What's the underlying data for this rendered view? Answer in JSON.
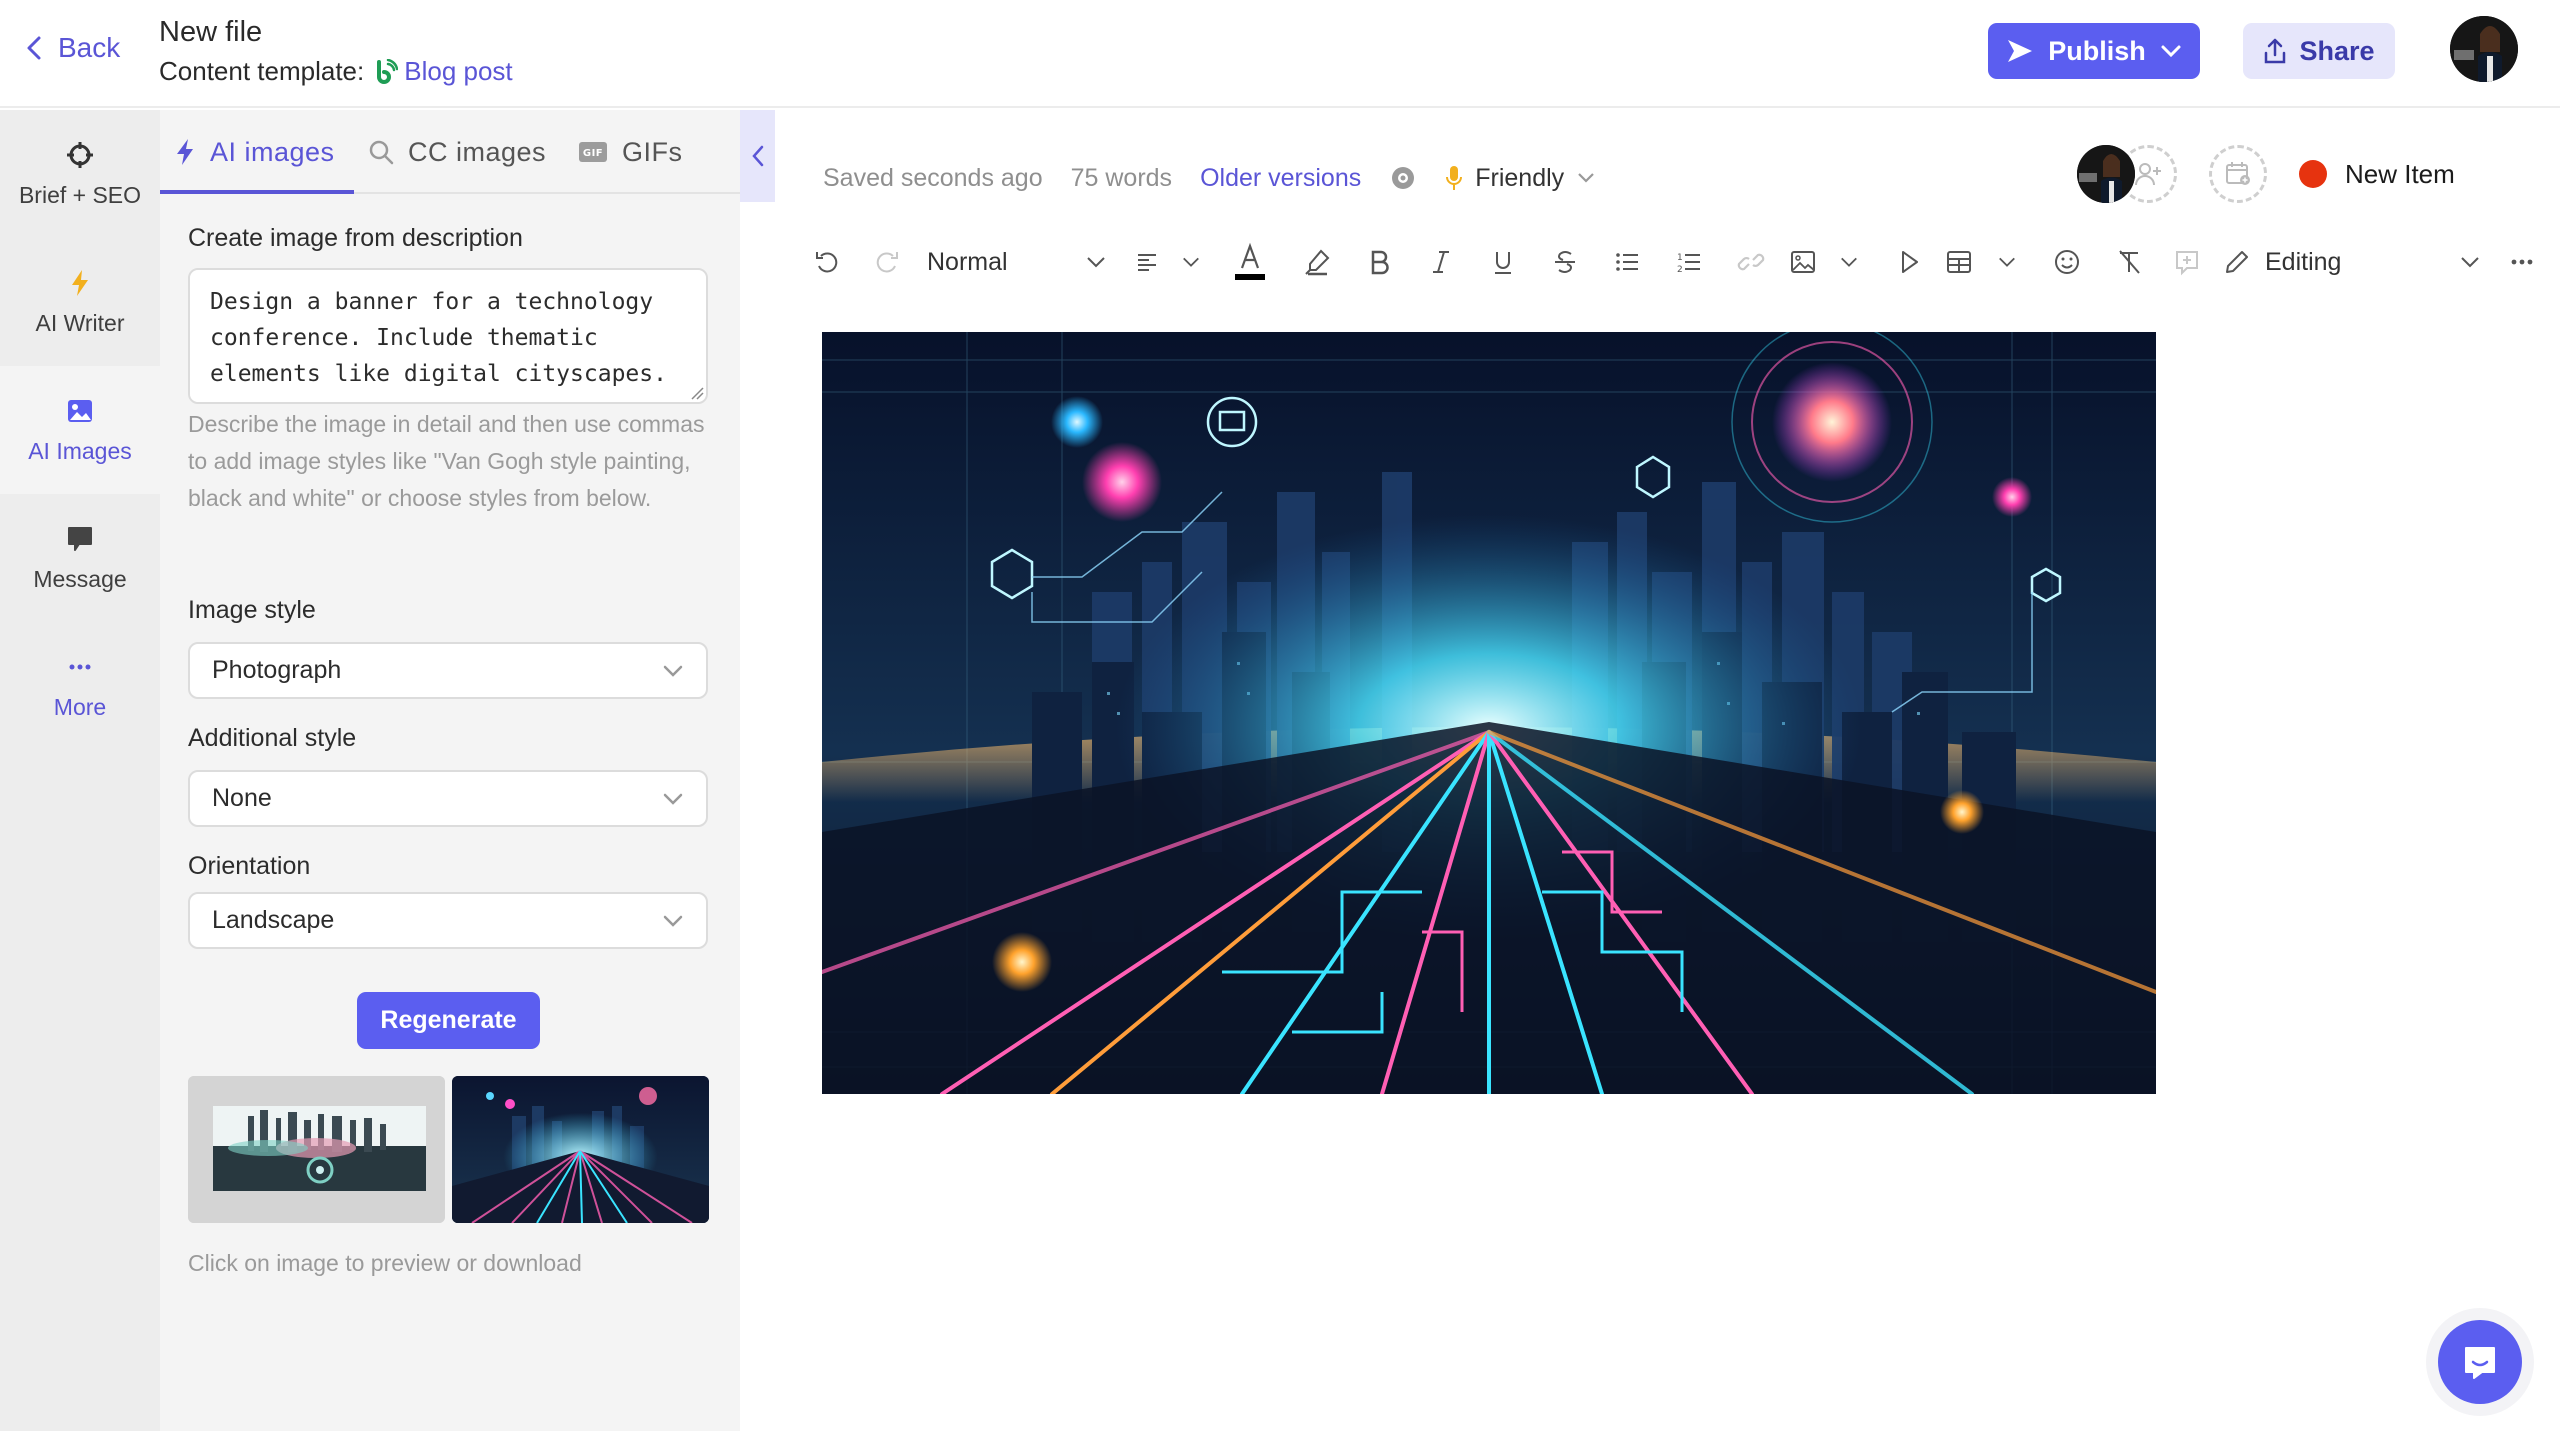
{
  "header": {
    "back_label": "Back",
    "file_title": "New file",
    "template_prefix": "Content template:",
    "template_name": "Blog post",
    "publish_label": "Publish",
    "share_label": "Share"
  },
  "rail": {
    "items": [
      {
        "label": "Brief + SEO",
        "icon": "crosshair-icon"
      },
      {
        "label": "AI Writer",
        "icon": "lightning-icon"
      },
      {
        "label": "AI Images",
        "icon": "image-icon",
        "active": true
      },
      {
        "label": "Message",
        "icon": "chat-bubble-icon"
      },
      {
        "label": "More",
        "icon": "ellipsis-icon"
      }
    ]
  },
  "panel": {
    "tabs": [
      {
        "label": "AI images",
        "icon": "lightning-icon",
        "active": true
      },
      {
        "label": "CC images",
        "icon": "search-icon"
      },
      {
        "label": "GIFs",
        "icon": "gif-icon"
      }
    ],
    "description_label": "Create image from description",
    "description_value": "Design a banner for a technology conference. Include thematic elements like digital cityscapes.",
    "helper_text": "Describe the image in detail and then use commas to add image styles like \"Van Gogh style painting, black and white\" or choose styles from below.",
    "image_style_label": "Image style",
    "image_style_value": "Photograph",
    "additional_style_label": "Additional style",
    "additional_style_value": "None",
    "orientation_label": "Orientation",
    "orientation_value": "Landscape",
    "regenerate_label": "Regenerate",
    "thumbnails": [
      {
        "description": "Digital cityscape with circuit board, pastel teal and pink"
      },
      {
        "description": "Neon futuristic city with glowing circuit road"
      }
    ],
    "caption": "Click on image to preview or download"
  },
  "editor": {
    "saved_status": "Saved seconds ago",
    "word_count": "75 words",
    "older_versions_label": "Older versions",
    "tone_label": "Friendly",
    "new_item_label": "New Item",
    "status_color": "#e6330f",
    "toolbar": {
      "paragraph_style": "Normal",
      "mode_label": "Editing",
      "text_color": "#000000"
    },
    "hero_image_description": "Neon futuristic digital cityscape with glowing circuit road and hexagon tech icons"
  },
  "colors": {
    "accent": "#5b5ef0",
    "accent_text": "#5a55d6",
    "share_bg": "#e6e6fb",
    "template_icon": "#1f9d55",
    "ai_writer_icon": "#f2b01e"
  }
}
